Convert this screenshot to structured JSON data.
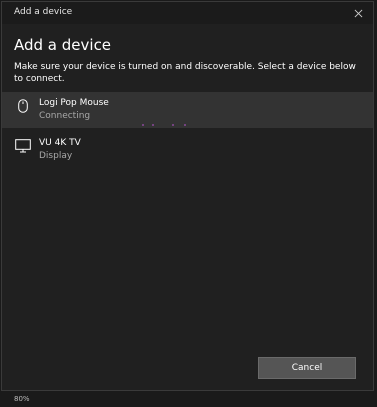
{
  "window": {
    "title": "Add a device",
    "heading": "Add a device",
    "description": "Make sure your device is turned on and discoverable. Select a device below to connect."
  },
  "devices": [
    {
      "name": "Logi Pop Mouse",
      "status": "Connecting",
      "icon": "mouse-icon",
      "selected": true
    },
    {
      "name": "VU 4K TV",
      "status": "Display",
      "icon": "monitor-icon",
      "selected": false
    }
  ],
  "footer": {
    "cancel_label": "Cancel"
  },
  "status_bar": {
    "zoom": "80%"
  },
  "colors": {
    "window_bg": "#202020",
    "selected_bg": "#333333",
    "button_bg": "#555555",
    "progress_accent": "#8a4a9a"
  }
}
